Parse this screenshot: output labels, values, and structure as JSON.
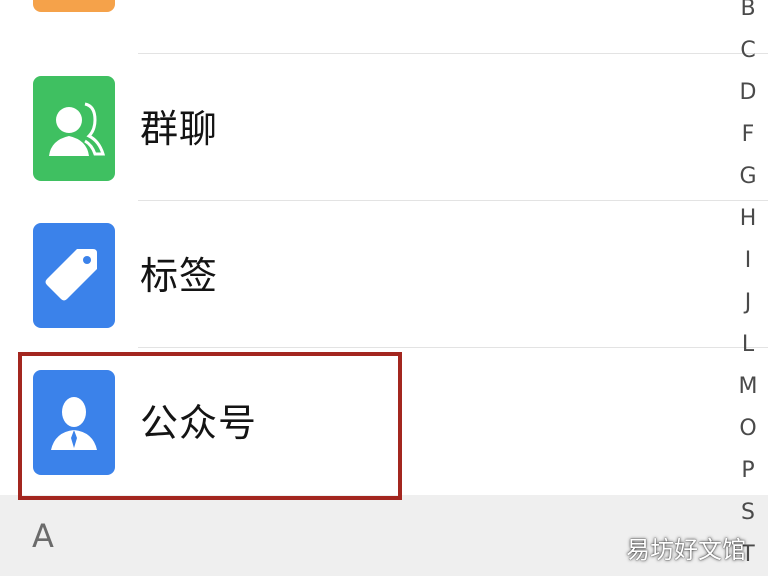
{
  "colors": {
    "orange": "#f5a24a",
    "green": "#3fc061",
    "blue": "#3b82ea",
    "highlight": "#a3261f"
  },
  "list": {
    "items": [
      {
        "label": "",
        "icon": "chat-bubble-icon",
        "color": "#f5a24a"
      },
      {
        "label": "群聊",
        "icon": "group-chat-icon",
        "color": "#3fc061"
      },
      {
        "label": "标签",
        "icon": "tag-icon",
        "color": "#3b82ea"
      },
      {
        "label": "公众号",
        "icon": "official-account-icon",
        "color": "#3b82ea"
      }
    ]
  },
  "section": {
    "letter": "A"
  },
  "alpha_index": [
    "B",
    "C",
    "D",
    "F",
    "G",
    "H",
    "I",
    "J",
    "L",
    "M",
    "O",
    "P",
    "S",
    "T"
  ],
  "watermark": "易坊好文馆"
}
